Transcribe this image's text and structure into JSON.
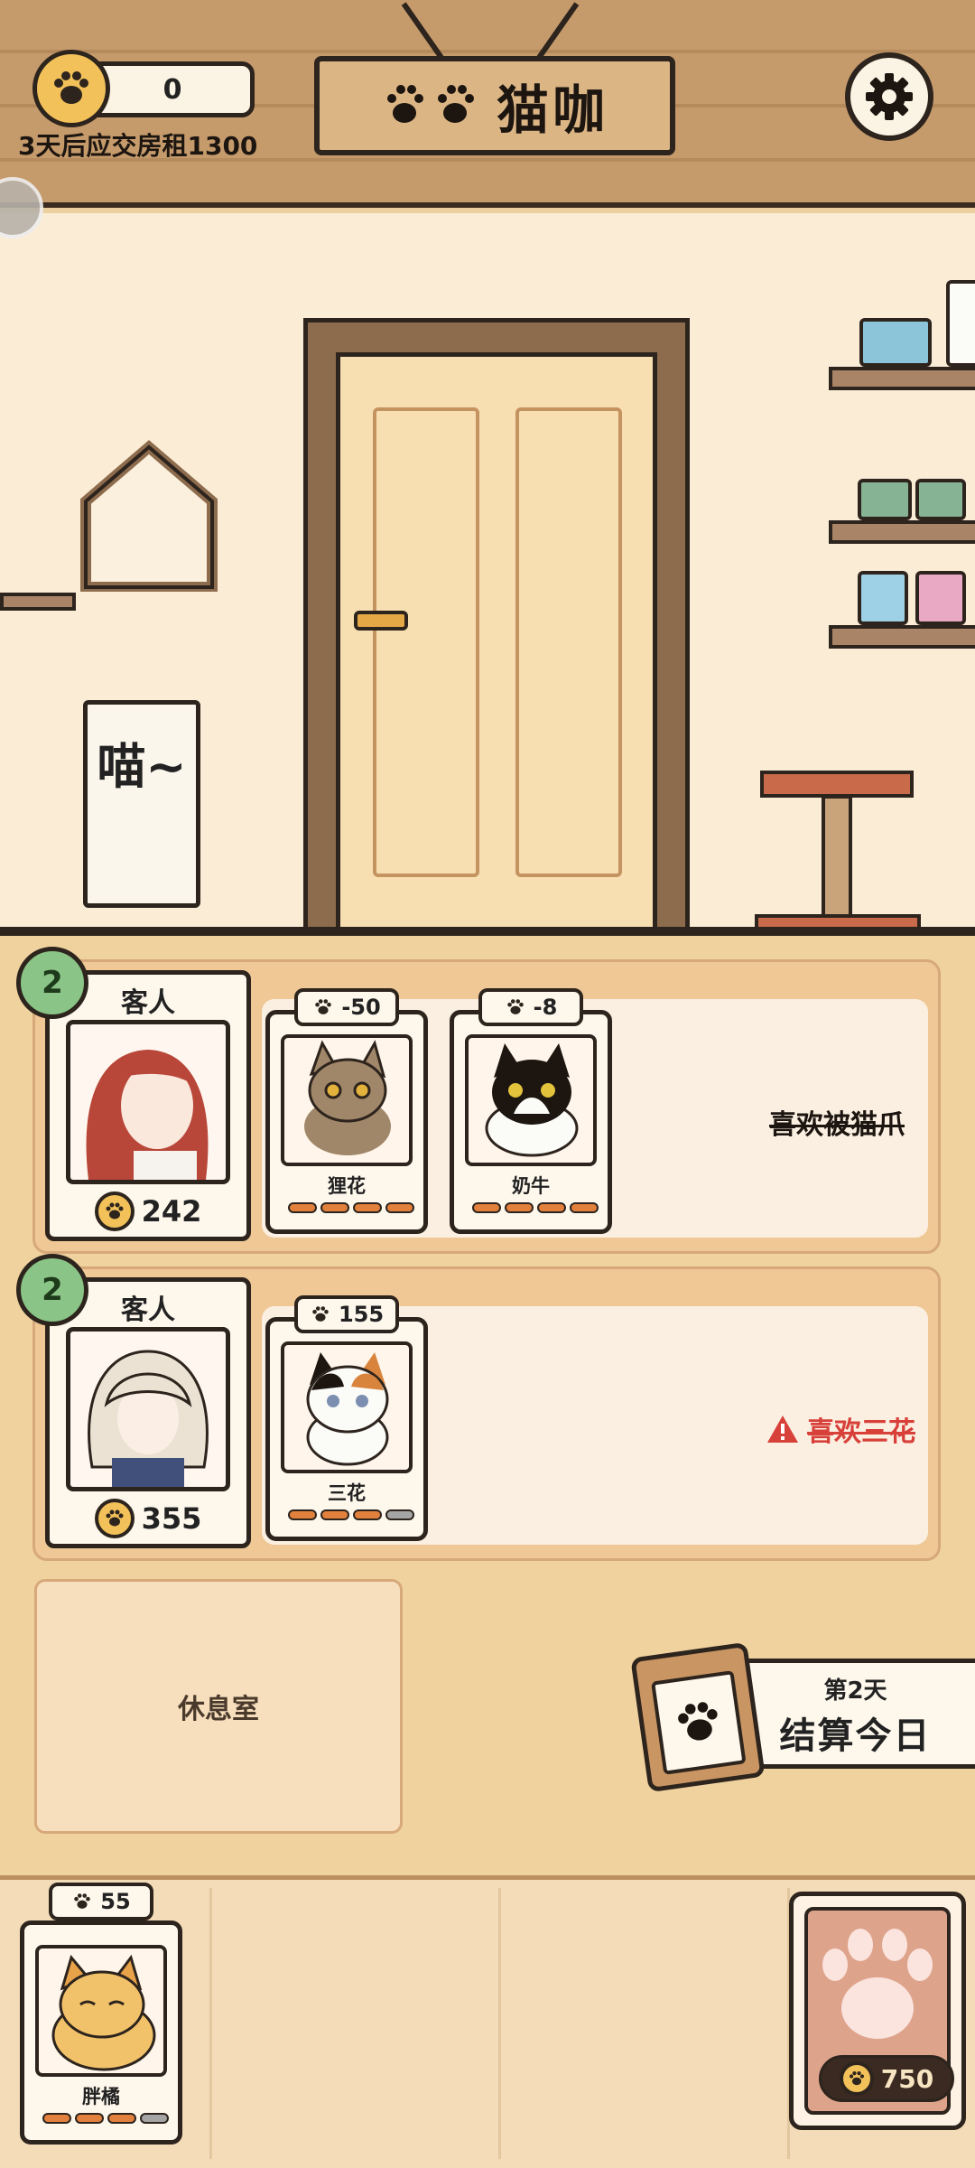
{
  "header": {
    "coins": "0",
    "rent_notice": "3天后应交房租1300",
    "title": "猫咖"
  },
  "room": {
    "meow_sign": "喵~"
  },
  "customers": [
    {
      "label": "客人",
      "swap_count": "2",
      "coins": "242",
      "preference": "喜欢被猫爪",
      "preference_color": "#1c1510",
      "cats": [
        {
          "name": "狸花",
          "score": "-50",
          "bars_on": 4,
          "bars_total": 4
        },
        {
          "name": "奶牛",
          "score": "-8",
          "bars_on": 4,
          "bars_total": 4
        }
      ]
    },
    {
      "label": "客人",
      "swap_count": "2",
      "coins": "355",
      "preference": "喜欢三花",
      "preference_color": "#d8403a",
      "cats": [
        {
          "name": "三花",
          "score": "155",
          "bars_on": 3,
          "bars_total": 4
        }
      ]
    }
  ],
  "lounge": {
    "label": "休息室"
  },
  "settle": {
    "day": "第2天",
    "label": "结算今日"
  },
  "hand": {
    "cat": {
      "name": "胖橘",
      "score": "55",
      "bars_on": 3,
      "bars_total": 4
    },
    "deck_cost": "750"
  },
  "colors": {
    "accent_orange": "#e2803d",
    "coin_gold": "#f2c15a",
    "swap_green": "#8ac486",
    "warning_red": "#d8403a"
  }
}
